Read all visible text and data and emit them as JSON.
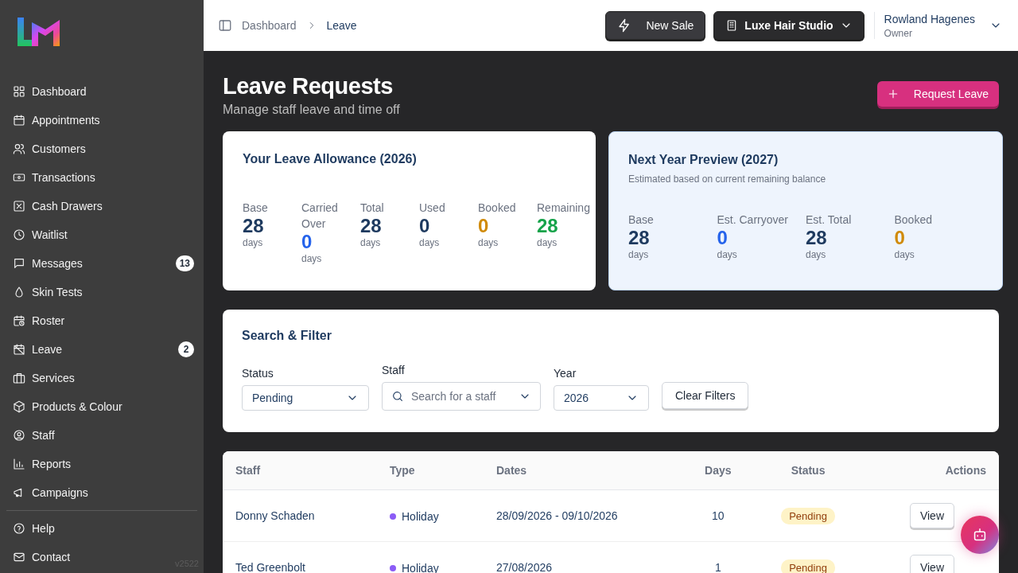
{
  "sidebar": {
    "items": [
      {
        "label": "Dashboard",
        "selected": false
      },
      {
        "label": "Appointments",
        "selected": false
      },
      {
        "label": "Customers",
        "selected": false
      },
      {
        "label": "Transactions",
        "selected": false
      },
      {
        "label": "Cash Drawers",
        "selected": false
      },
      {
        "label": "Waitlist",
        "selected": false
      },
      {
        "label": "Messages",
        "selected": false,
        "badge": "13"
      },
      {
        "label": "Skin Tests",
        "selected": false
      },
      {
        "label": "Roster",
        "selected": false
      },
      {
        "label": "Leave",
        "selected": false,
        "badge": "2"
      },
      {
        "label": "Services",
        "selected": false
      },
      {
        "label": "Products & Colour",
        "selected": false
      },
      {
        "label": "Staff",
        "selected": false
      },
      {
        "label": "Reports",
        "selected": false
      },
      {
        "label": "Campaigns",
        "selected": false
      }
    ],
    "footer_items": [
      {
        "label": "Help"
      },
      {
        "label": "Contact"
      }
    ],
    "version": "v2522"
  },
  "header": {
    "breadcrumbs": [
      "Dashboard",
      "Leave"
    ],
    "new_sale": "New Sale",
    "business": "Luxe Hair Studio",
    "user": {
      "name": "Rowland Hagenes",
      "role": "Owner"
    }
  },
  "page": {
    "title": "Leave Requests",
    "subtitle": "Manage staff leave and time off",
    "action": "Request Leave"
  },
  "allowance": {
    "title": "Your Leave Allowance (2026)",
    "stats": [
      {
        "label": "Base",
        "value": "28",
        "unit": "days",
        "color": "#1e3a5f"
      },
      {
        "label": "Carried Over",
        "value": "0",
        "unit": "days",
        "color": "#2563eb"
      },
      {
        "label": "Total",
        "value": "28",
        "unit": "days",
        "color": "#1e3a5f"
      },
      {
        "label": "Used",
        "value": "0",
        "unit": "days",
        "color": "#1e3a5f"
      },
      {
        "label": "Booked",
        "value": "0",
        "unit": "days",
        "color": "#d08a06"
      },
      {
        "label": "Remaining",
        "value": "28",
        "unit": "days",
        "color": "#16a34a"
      }
    ]
  },
  "preview": {
    "title": "Next Year Preview (2027)",
    "note": "Estimated based on current remaining balance",
    "stats": [
      {
        "label": "Base",
        "value": "28",
        "unit": "days",
        "color": "#1e3a5f"
      },
      {
        "label": "Est. Carryover",
        "value": "0",
        "unit": "days",
        "color": "#2563eb"
      },
      {
        "label": "Est. Total",
        "value": "28",
        "unit": "days",
        "color": "#1e3a5f"
      },
      {
        "label": "Booked",
        "value": "0",
        "unit": "days",
        "color": "#d08a06"
      }
    ]
  },
  "filters": {
    "title": "Search & Filter",
    "fields": [
      {
        "kind": "select",
        "label": "Status",
        "value": "Pending"
      },
      {
        "kind": "search",
        "label": "Staff",
        "placeholder": "Search for a staff"
      },
      {
        "kind": "select",
        "label": "Year",
        "value": "2026"
      }
    ],
    "clear": "Clear Filters"
  },
  "table": {
    "columns": [
      "Staff",
      "Type",
      "Dates",
      "Days",
      "Status",
      "Actions"
    ],
    "rows": [
      {
        "staff": "Donny Schaden",
        "type": "Holiday",
        "color": "#8b5cf6",
        "dates": "28/09/2026 - 09/10/2026",
        "days": "10",
        "status": "Pending",
        "action": "View"
      },
      {
        "staff": "Ted Greenbolt",
        "type": "Holiday",
        "color": "#8b5cf6",
        "dates": "27/08/2026",
        "days": "1",
        "status": "Pending",
        "action": "View"
      }
    ]
  }
}
